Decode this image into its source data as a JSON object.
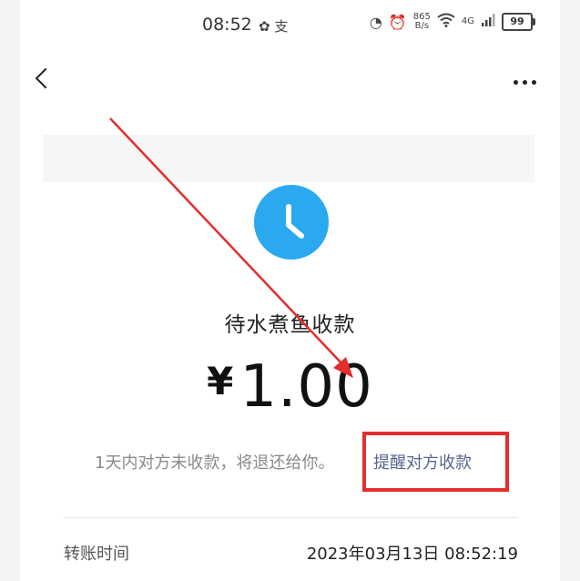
{
  "status_bar": {
    "time": "08:52",
    "app_icons": "✿ 支",
    "net_speed_value": "865",
    "net_speed_unit": "B/s",
    "signal_label": "4G",
    "battery": "99"
  },
  "status": {
    "title": "待水煮鱼收款",
    "currency": "¥",
    "amount": "1.00",
    "notice": "1天内对方未收款，将退还给你。",
    "remind_link": "提醒对方收款"
  },
  "details": {
    "transfer_time_label": "转账时间",
    "transfer_time_value": "2023年03月13日 08:52:19"
  },
  "colors": {
    "clock_icon_bg": "#2aa9f0",
    "link": "#56658f",
    "annotation_red": "#e42d2d"
  },
  "icons": [
    "back-icon",
    "more-icon",
    "clock-icon",
    "wifi-icon",
    "signal-icon",
    "alarm-icon",
    "battery-icon"
  ]
}
